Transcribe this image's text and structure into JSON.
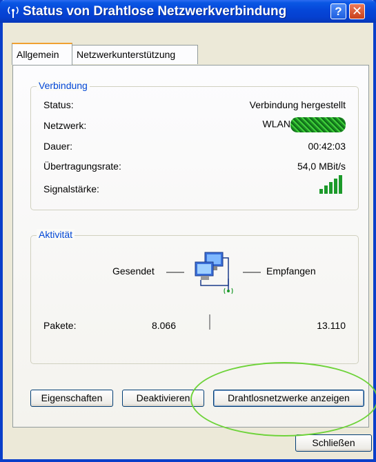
{
  "window": {
    "title": "Status von Drahtlose Netzwerkverbindung",
    "help_label": "?",
    "close_label": "✕"
  },
  "tabs": [
    {
      "label": "Allgemein",
      "active": true
    },
    {
      "label": "Netzwerkunterstützung",
      "active": false
    }
  ],
  "connection": {
    "group_label": "Verbindung",
    "rows": [
      {
        "label": "Status:",
        "value": "Verbindung hergestellt"
      },
      {
        "label": "Netzwerk:",
        "value": "WLAN"
      },
      {
        "label": "Dauer:",
        "value": "00:42:03"
      },
      {
        "label": "Übertragungsrate:",
        "value": "54,0 MBit/s"
      },
      {
        "label": "Signalstärke:",
        "value": ""
      }
    ],
    "signal_bars": 5
  },
  "activity": {
    "group_label": "Aktivität",
    "sent_label": "Gesendet",
    "received_label": "Empfangen",
    "packets_label": "Pakete:",
    "packets_sent": "8.066",
    "packets_received": "13.110"
  },
  "buttons": {
    "properties": "Eigenschaften",
    "deactivate": "Deaktivieren",
    "show_wireless": "Drahtlosnetzwerke anzeigen",
    "close": "Schließen"
  },
  "colors": {
    "titlebar": "#0546d8",
    "group_label": "#0046d5",
    "highlight_ellipse": "#6ed33a",
    "signal": "#1c9a2a"
  }
}
